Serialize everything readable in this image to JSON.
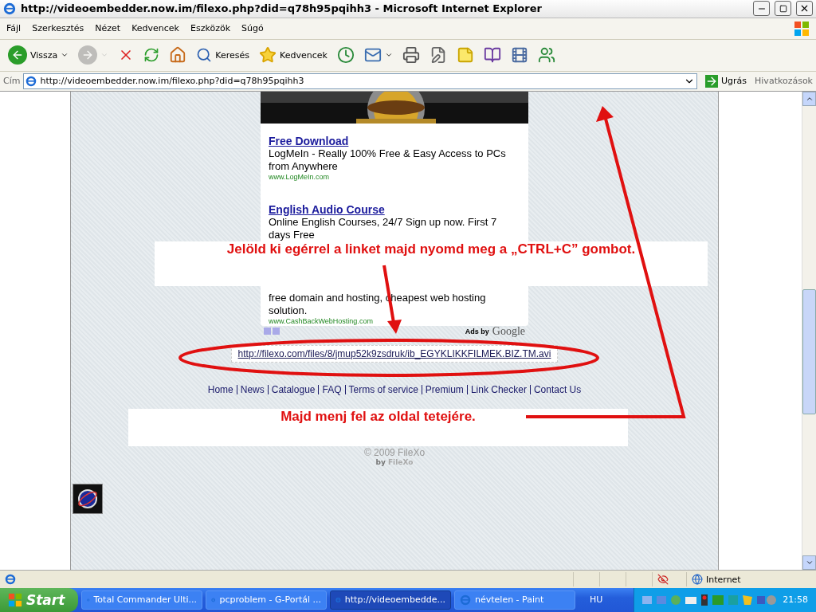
{
  "window": {
    "title": "http://videoembedder.now.im/filexo.php?did=q78h95pqihh3 - Microsoft Internet Explorer"
  },
  "menu": [
    "Fájl",
    "Szerkesztés",
    "Nézet",
    "Kedvencek",
    "Eszközök",
    "Súgó"
  ],
  "toolbar": [
    {
      "kind": "back",
      "label": "Vissza",
      "disabled": false
    },
    {
      "kind": "forward",
      "disabled": true
    },
    {
      "kind": "stop",
      "disabled": false
    },
    {
      "kind": "refresh",
      "disabled": false
    },
    {
      "kind": "home",
      "disabled": false
    },
    {
      "kind": "search",
      "label": "Keresés",
      "disabled": false
    },
    {
      "kind": "favorites",
      "label": "Kedvencek",
      "disabled": false
    },
    {
      "kind": "history",
      "disabled": false
    },
    {
      "kind": "mail",
      "disabled": false
    },
    {
      "kind": "print",
      "disabled": false
    },
    {
      "kind": "edit",
      "disabled": false
    },
    {
      "kind": "note",
      "disabled": false
    },
    {
      "kind": "research",
      "disabled": false
    },
    {
      "kind": "media",
      "disabled": false
    },
    {
      "kind": "messenger",
      "disabled": false
    }
  ],
  "address": {
    "label": "Cím",
    "value": "http://videoembedder.now.im/filexo.php?did=q78h95pqihh3",
    "go": "Ugrás",
    "links": "Hivatkozások"
  },
  "page": {
    "ads": [
      {
        "title": "Free Download",
        "text": "LogMeIn - Really 100% Free & Easy Access to PCs from Anywhere",
        "url": "www.LogMeIn.com"
      },
      {
        "title": "English Audio Course",
        "text": "Online English Courses, 24/7 Sign up now. First 7 days Free"
      },
      {
        "text": "free domain and hosting, cheapest web hosting solution.",
        "url": "www.CashBackWebHosting.com"
      }
    ],
    "ads_by": "Ads by",
    "ads_brand": "Google",
    "file_link": "http://filexo.com/files/8/jmup52k9zsdruk/ib_EGYKLIKKFILMEK.BIZ.TM.avi",
    "footer_links": [
      "Home",
      "News",
      "Catalogue",
      "FAQ",
      "Terms of service",
      "Premium",
      "Link Checker",
      "Contact Us"
    ],
    "copyright": "© 2009 FileXo",
    "by": "by",
    "by_name": "FileXo"
  },
  "annotations": [
    {
      "text": "Jelöld ki egérrel a linket majd nyomd meg a „CTRL+C” gombot."
    },
    {
      "text": "Majd menj fel az oldal tetejére."
    }
  ],
  "status": {
    "zone": "Internet"
  },
  "taskbar": {
    "start": "Start",
    "tasks": [
      {
        "label": "Total Commander Ulti...",
        "selected": false
      },
      {
        "label": "pcproblem - G-Portál ...",
        "selected": false
      },
      {
        "label": "http://videoembedde...",
        "selected": true
      },
      {
        "label": "névtelen - Paint",
        "selected": false
      }
    ],
    "lang": "HU",
    "clock": "21:58"
  }
}
